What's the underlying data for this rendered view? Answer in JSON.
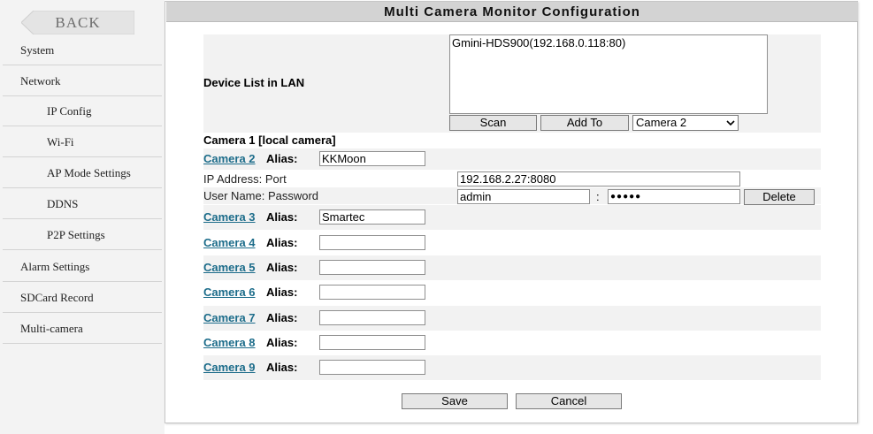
{
  "sidebar": {
    "back_label": "BACK",
    "items": [
      {
        "label": "System"
      },
      {
        "label": "Network"
      },
      {
        "label": "IP Config"
      },
      {
        "label": "Wi-Fi"
      },
      {
        "label": "AP Mode Settings"
      },
      {
        "label": "DDNS"
      },
      {
        "label": "P2P Settings"
      },
      {
        "label": "Alarm Settings"
      },
      {
        "label": "SDCard Record"
      },
      {
        "label": "Multi-camera"
      }
    ]
  },
  "title": "Multi Camera Monitor Configuration",
  "device_list": {
    "label": "Device List in LAN",
    "items": [
      "Gmini-HDS900(192.168.0.118:80)"
    ],
    "scan_label": "Scan",
    "add_label": "Add To",
    "camera_select": "Camera 2"
  },
  "camera1_label": "Camera 1 [local camera]",
  "alias_label": "Alias:",
  "ip_label": "IP Address: Port",
  "user_label": "User Name: Password",
  "separator": ":",
  "delete_label": "Delete",
  "camera2": {
    "name": "Camera 2",
    "alias": "KKMoon",
    "ip": "192.168.2.27:8080",
    "username": "admin",
    "password": "●●●●●"
  },
  "cameras": [
    {
      "name": "Camera 3",
      "alias": "Smartec"
    },
    {
      "name": "Camera 4",
      "alias": ""
    },
    {
      "name": "Camera 5",
      "alias": ""
    },
    {
      "name": "Camera 6",
      "alias": ""
    },
    {
      "name": "Camera 7",
      "alias": ""
    },
    {
      "name": "Camera 8",
      "alias": ""
    },
    {
      "name": "Camera 9",
      "alias": ""
    }
  ],
  "save_label": "Save",
  "cancel_label": "Cancel"
}
